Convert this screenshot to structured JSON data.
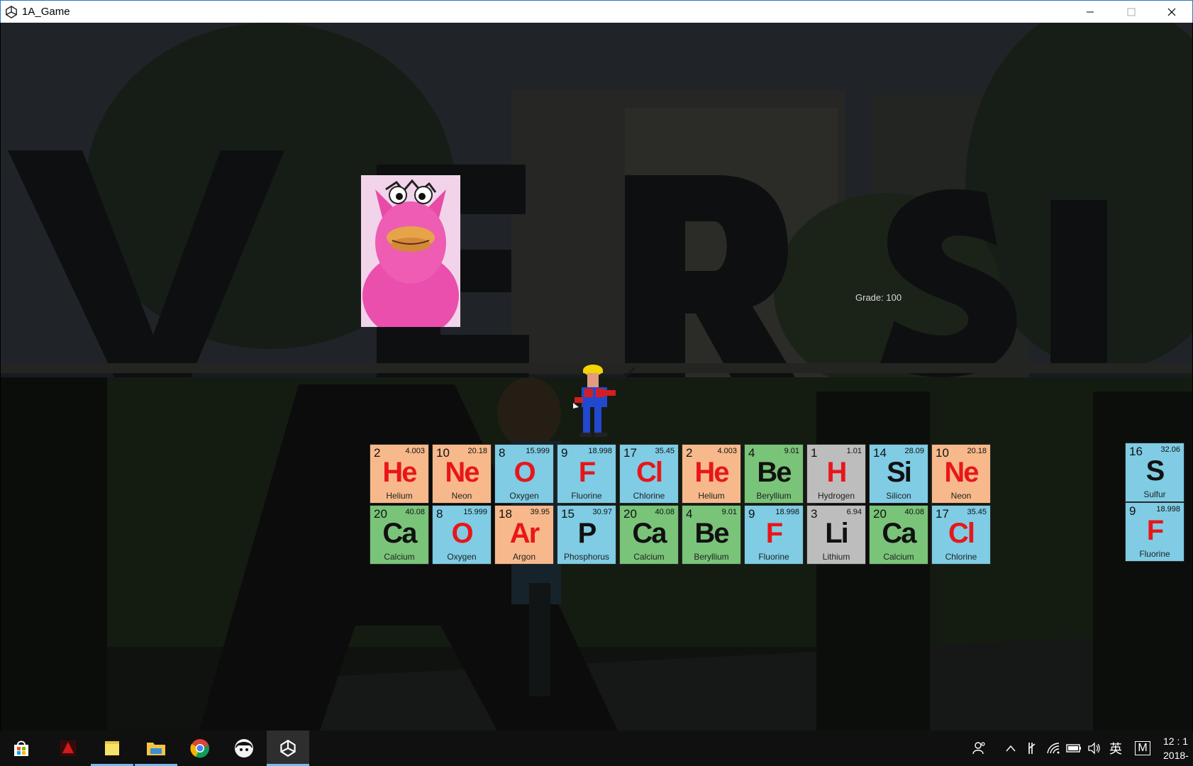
{
  "window": {
    "title": "1A_Game"
  },
  "hud": {
    "grade": "Grade: 100"
  },
  "colors": {
    "noble": "#f7b98b",
    "nonmetal": "#7fcce4",
    "alkaline": "#79c479",
    "metalloid": "#bdbdbd",
    "red_symbol": "#e8161a",
    "black_symbol": "#111111"
  },
  "tiles_row1": [
    {
      "num": "2",
      "mass": "4.003",
      "sym": "He",
      "name": "Helium",
      "cat": "noble",
      "symColor": "red"
    },
    {
      "num": "10",
      "mass": "20.18",
      "sym": "Ne",
      "name": "Neon",
      "cat": "noble",
      "symColor": "red"
    },
    {
      "num": "8",
      "mass": "15.999",
      "sym": "O",
      "name": "Oxygen",
      "cat": "nonmetal",
      "symColor": "red"
    },
    {
      "num": "9",
      "mass": "18.998",
      "sym": "F",
      "name": "Fluorine",
      "cat": "nonmetal",
      "symColor": "red"
    },
    {
      "num": "17",
      "mass": "35.45",
      "sym": "Cl",
      "name": "Chlorine",
      "cat": "nonmetal",
      "symColor": "red"
    },
    {
      "num": "2",
      "mass": "4.003",
      "sym": "He",
      "name": "Helium",
      "cat": "noble",
      "symColor": "red"
    },
    {
      "num": "4",
      "mass": "9.01",
      "sym": "Be",
      "name": "Beryllium",
      "cat": "alkaline",
      "symColor": "black"
    },
    {
      "num": "1",
      "mass": "1.01",
      "sym": "H",
      "name": "Hydrogen",
      "cat": "metalloid",
      "symColor": "red"
    },
    {
      "num": "14",
      "mass": "28.09",
      "sym": "Si",
      "name": "Silicon",
      "cat": "nonmetal",
      "symColor": "black"
    },
    {
      "num": "10",
      "mass": "20.18",
      "sym": "Ne",
      "name": "Neon",
      "cat": "noble",
      "symColor": "red"
    }
  ],
  "tiles_row2": [
    {
      "num": "20",
      "mass": "40.08",
      "sym": "Ca",
      "name": "Calcium",
      "cat": "alkaline",
      "symColor": "black"
    },
    {
      "num": "8",
      "mass": "15.999",
      "sym": "O",
      "name": "Oxygen",
      "cat": "nonmetal",
      "symColor": "red"
    },
    {
      "num": "18",
      "mass": "39.95",
      "sym": "Ar",
      "name": "Argon",
      "cat": "noble",
      "symColor": "red"
    },
    {
      "num": "15",
      "mass": "30.97",
      "sym": "P",
      "name": "Phosphorus",
      "cat": "nonmetal",
      "symColor": "black"
    },
    {
      "num": "20",
      "mass": "40.08",
      "sym": "Ca",
      "name": "Calcium",
      "cat": "alkaline",
      "symColor": "black"
    },
    {
      "num": "4",
      "mass": "9.01",
      "sym": "Be",
      "name": "Beryllium",
      "cat": "alkaline",
      "symColor": "black"
    },
    {
      "num": "9",
      "mass": "18.998",
      "sym": "F",
      "name": "Fluorine",
      "cat": "nonmetal",
      "symColor": "red"
    },
    {
      "num": "3",
      "mass": "6.94",
      "sym": "Li",
      "name": "Lithium",
      "cat": "metalloid",
      "symColor": "black"
    },
    {
      "num": "20",
      "mass": "40.08",
      "sym": "Ca",
      "name": "Calcium",
      "cat": "alkaline",
      "symColor": "black"
    },
    {
      "num": "17",
      "mass": "35.45",
      "sym": "Cl",
      "name": "Chlorine",
      "cat": "nonmetal",
      "symColor": "red"
    }
  ],
  "tiles_side": [
    {
      "num": "16",
      "mass": "32.06",
      "sym": "S",
      "name": "Sulfur",
      "cat": "nonmetal",
      "symColor": "black"
    },
    {
      "num": "9",
      "mass": "18.998",
      "sym": "F",
      "name": "Fluorine",
      "cat": "nonmetal",
      "symColor": "red"
    }
  ],
  "taskbar": {
    "apps": [
      {
        "name": "store-icon"
      },
      {
        "name": "red-app-icon"
      },
      {
        "name": "sticky-notes-icon"
      },
      {
        "name": "file-explorer-icon"
      },
      {
        "name": "chrome-icon"
      },
      {
        "name": "avatar-app-icon"
      },
      {
        "name": "unity-icon"
      }
    ],
    "ime": "英",
    "ime_mode": "M",
    "clock_time": "12 : 1",
    "clock_date": "2018-"
  }
}
